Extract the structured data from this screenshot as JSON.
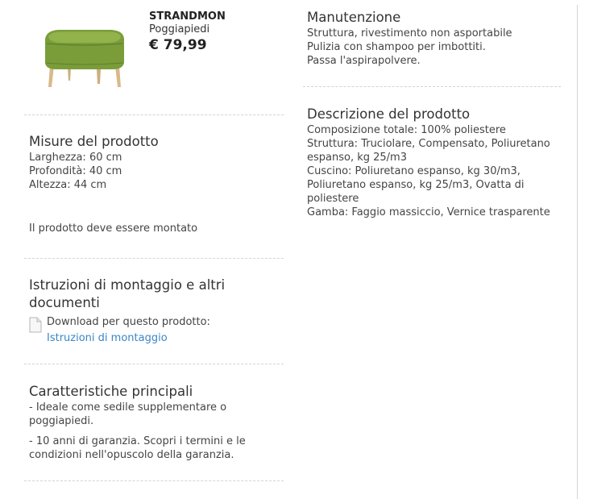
{
  "product": {
    "name": "STRANDMON",
    "type": "Poggiapiedi",
    "price": "€ 79,99",
    "image_color": "#7a9d3a"
  },
  "misure": {
    "title": "Misure del prodotto",
    "lines": [
      "Larghezza: 60 cm",
      "Profondità: 40 cm",
      "Altezza: 44 cm"
    ],
    "note": "Il prodotto deve essere montato"
  },
  "istruzioni": {
    "title": "Istruzioni di montaggio e altri documenti",
    "download_label": "Download per questo prodotto:",
    "link_label": "Istruzioni di montaggio",
    "icon": "document-icon"
  },
  "caratteristiche": {
    "title": "Caratteristiche principali",
    "items": [
      "- Ideale come sedile supplementare o poggiapiedi.",
      "- 10 anni di garanzia. Scopri i termini e le condizioni nell'opuscolo della garanzia."
    ]
  },
  "manutenzione": {
    "title": "Manutenzione",
    "lines": [
      "Struttura, rivestimento non asportabile",
      "Pulizia con shampoo per imbottiti.",
      "Passa l'aspirapolvere."
    ]
  },
  "descrizione": {
    "title": "Descrizione del prodotto",
    "lines": [
      "Composizione totale: 100% poliestere",
      "Struttura: Truciolare, Compensato, Poliuretano espanso, kg 25/m3",
      "Cuscino: Poliuretano espanso, kg 30/m3, Poliuretano espanso, kg 25/m3, Ovatta di poliestere",
      "Gamba: Faggio massiccio, Vernice trasparente"
    ]
  },
  "colors": {
    "link": "#3a86c8",
    "separator": "#d4d4d4"
  }
}
